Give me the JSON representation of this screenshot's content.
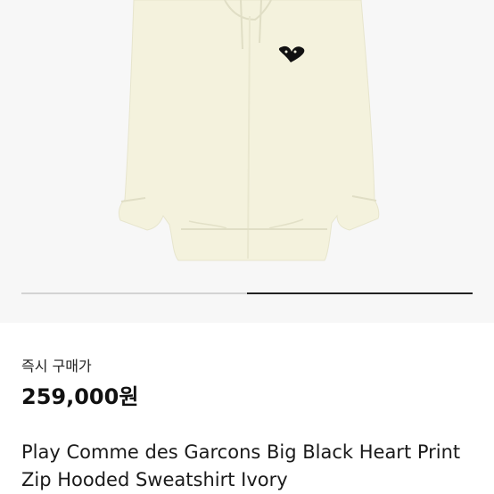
{
  "product": {
    "image_alt": "Play Comme des Garcons hooded sweatshirt ivory",
    "gallery_progress": 0.5,
    "price_label": "즉시 구매가",
    "price": "259,000원",
    "title": "Play Comme des Garcons Big Black Heart Print Zip Hooded Sweatshirt Ivory"
  },
  "colors": {
    "hoodie": "#f4f2dd",
    "hoodie_shadow": "#e7e5cd",
    "heart": "#111111",
    "progress_active": "#222222",
    "progress_track": "#d3d3d3"
  }
}
